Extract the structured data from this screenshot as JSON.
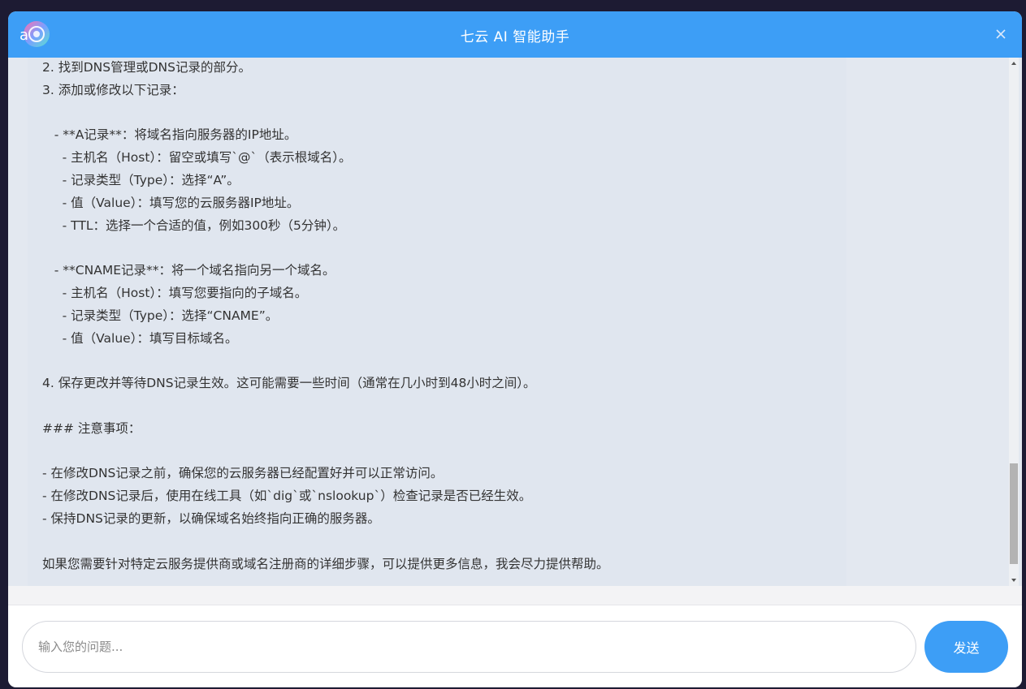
{
  "header": {
    "title": "七云 AI 智能助手",
    "close_label": "×"
  },
  "colors": {
    "accent": "#3d9ef6",
    "chat_background": "#e3e8f0"
  },
  "message": {
    "lines": [
      "2. 找到DNS管理或DNS记录的部分。",
      "3. 添加或修改以下记录：",
      "",
      "   - **A记录**：将域名指向服务器的IP地址。",
      "     - 主机名（Host）：留空或填写`@`（表示根域名）。",
      "     - 记录类型（Type）：选择“A”。",
      "     - 值（Value）：填写您的云服务器IP地址。",
      "     - TTL：选择一个合适的值，例如300秒（5分钟）。",
      "",
      "   - **CNAME记录**：将一个域名指向另一个域名。",
      "     - 主机名（Host）：填写您要指向的子域名。",
      "     - 记录类型（Type）：选择“CNAME”。",
      "     - 值（Value）：填写目标域名。",
      "",
      "4. 保存更改并等待DNS记录生效。这可能需要一些时间（通常在几小时到48小时之间）。",
      "",
      "### 注意事项：",
      "",
      "- 在修改DNS记录之前，确保您的云服务器已经配置好并可以正常访问。",
      "- 在修改DNS记录后，使用在线工具（如`dig`或`nslookup`）检查记录是否已经生效。",
      "- 保持DNS记录的更新，以确保域名始终指向正确的服务器。",
      "",
      "如果您需要针对特定云服务提供商或域名注册商的详细步骤，可以提供更多信息，我会尽力提供帮助。"
    ]
  },
  "input": {
    "placeholder": "输入您的问题...",
    "value": ""
  },
  "send_button": {
    "label": "发送"
  }
}
